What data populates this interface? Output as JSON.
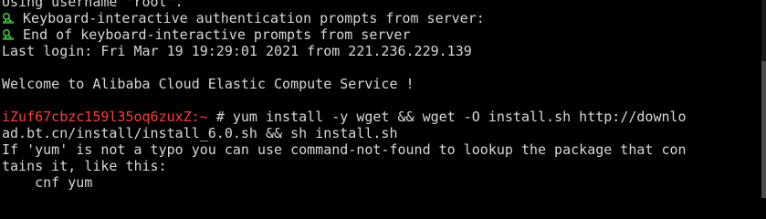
{
  "terminal": {
    "lines": {
      "username": "Using username \"root\".",
      "kbd_start": " Keyboard-interactive authentication prompts from server:",
      "kbd_end": " End of keyboard-interactive prompts from server",
      "last_login": "Last login: Fri Mar 19 19:29:01 2021 from 221.236.229.139",
      "welcome": "Welcome to Alibaba Cloud Elastic Compute Service !",
      "command_wrap": "ad.bt.cn/install/install_6.0.sh && sh install.sh",
      "err1": "If 'yum' is not a typo you can use command-not-found to lookup the package that con",
      "err2": "tains it, like this:",
      "err3": "    cnf yum"
    },
    "prompt": {
      "host": "iZuf67cbzc159l35oq6zuxZ:~",
      "symbol": " # ",
      "command": "yum install -y wget && wget -O install.sh http://downlo"
    },
    "colors": {
      "background": "#000000",
      "foreground": "#d8d8d8",
      "prompt_host": "#ff3b3b",
      "icon_green": "#3fbf3f"
    },
    "icons": [
      "key-icon",
      "key-icon"
    ]
  }
}
